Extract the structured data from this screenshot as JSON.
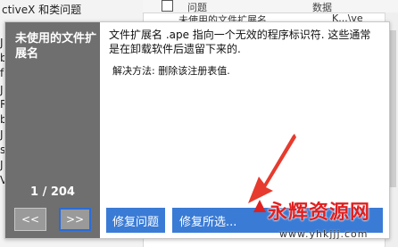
{
  "background": {
    "list_items": [
      "ctiveX 和类问题",
      "J",
      "b",
      "f",
      "J",
      "R",
      "b",
      "J",
      "s",
      "J",
      "V"
    ],
    "table_headers": [
      "问题",
      "数据"
    ],
    "row_text": "未使用的文件扩展名",
    "row_value": "K...\\ve"
  },
  "panel": {
    "title": "未使用的文件扩展名",
    "description": "文件扩展名 .ape 指向一个无效的程序标识符. 这些通常是在卸载软件后遗留下来的.",
    "solution": "解决方法: 删除该注册表值.",
    "counter": "1 / 204",
    "prev_label": "<<",
    "next_label": ">>",
    "fix_label": "修复问题",
    "second_label": "修复所选..."
  },
  "watermark": {
    "text": "永辉资源网",
    "url": "www.yhkjjj.com"
  },
  "colors": {
    "accent_blue": "#3a7bd5",
    "panel_dark": "#6f6f6f",
    "watermark_red": "#e02020"
  }
}
